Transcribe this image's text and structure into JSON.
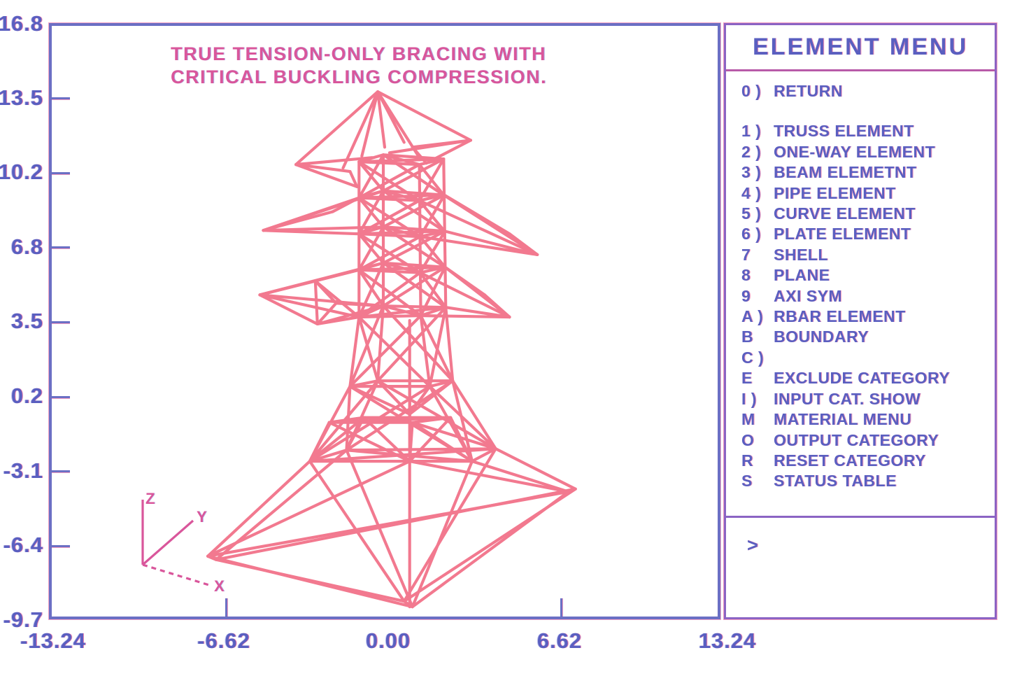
{
  "plot": {
    "title_line1": "TRUE TENSION-ONLY BRACING WITH",
    "title_line2": "CRITICAL BUCKLING COMPRESSION.",
    "model_color": "#f2798f",
    "axis_color": "#6b6fc4",
    "background": "#ffffff"
  },
  "axes": {
    "y_ticks": [
      "16.8",
      "13.5",
      "10.2",
      "6.8",
      "3.5",
      "0.2",
      "-3.1",
      "-6.4",
      "-9.7"
    ],
    "x_ticks": [
      "-13.24",
      "-6.62",
      "0.00",
      "6.62",
      "13.24"
    ]
  },
  "triad": {
    "z_label": "Z",
    "y_label": "Y",
    "x_label": "X"
  },
  "menu": {
    "title": "ELEMENT MENU",
    "prompt": ">",
    "items": [
      {
        "key": "0 )",
        "label": "RETURN",
        "gap": false
      },
      {
        "key": "1 )",
        "label": "TRUSS ELEMENT",
        "gap": true
      },
      {
        "key": "2 )",
        "label": "ONE-WAY ELEMENT",
        "gap": false
      },
      {
        "key": "3 )",
        "label": "BEAM ELEMETNT",
        "gap": false
      },
      {
        "key": "4 )",
        "label": "PIPE  ELEMENT",
        "gap": false
      },
      {
        "key": "5 )",
        "label": "CURVE ELEMENT",
        "gap": false
      },
      {
        "key": "6 )",
        "label": "PLATE ELEMENT",
        "gap": false
      },
      {
        "key": "7",
        "label": "SHELL",
        "gap": false
      },
      {
        "key": "8",
        "label": "PLANE",
        "gap": false
      },
      {
        "key": "9",
        "label": "AXI  SYM",
        "gap": false
      },
      {
        "key": "A )",
        "label": "RBAR ELEMENT",
        "gap": false
      },
      {
        "key": "B",
        "label": "BOUNDARY",
        "gap": false
      },
      {
        "key": "C )",
        "label": "",
        "gap": false
      },
      {
        "key": "E",
        "label": "EXCLUDE CATEGORY",
        "gap": false
      },
      {
        "key": "I )",
        "label": "INPUT CAT.  SHOW",
        "gap": false
      },
      {
        "key": "M",
        "label": "MATERIAL MENU",
        "gap": false
      },
      {
        "key": "O",
        "label": "OUTPUT CATEGORY",
        "gap": false
      },
      {
        "key": "R",
        "label": "RESET CATEGORY",
        "gap": false
      },
      {
        "key": "S",
        "label": "STATUS TABLE",
        "gap": false
      }
    ]
  },
  "chart_data": {
    "type": "scatter",
    "title": "TRUE TENSION-ONLY BRACING WITH CRITICAL BUCKLING COMPRESSION.",
    "xlabel": "",
    "ylabel": "",
    "xlim": [
      -13.24,
      13.24
    ],
    "ylim": [
      -9.7,
      16.8
    ],
    "grid": false,
    "legend": "none",
    "description": "3D wireframe finite-element model of a lattice transmission tower, isometric view, drawn in pink line elements.",
    "x_tick_values": [
      -13.24,
      -6.62,
      0.0,
      6.62,
      13.24
    ],
    "y_tick_values": [
      16.8,
      13.5,
      10.2,
      6.8,
      3.5,
      0.2,
      -3.1,
      -6.4,
      -9.7
    ]
  }
}
